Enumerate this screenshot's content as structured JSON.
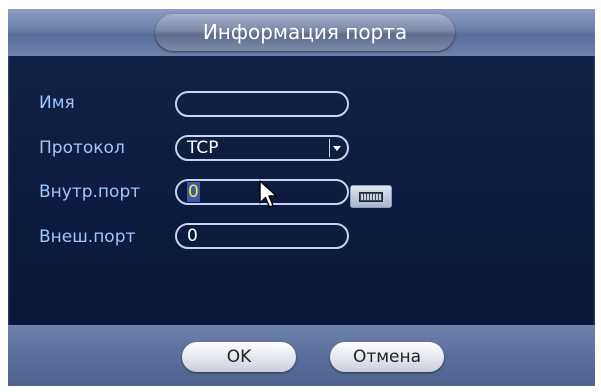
{
  "dialog": {
    "title": "Информация порта"
  },
  "form": {
    "name_label": "Имя",
    "name_value": "",
    "protocol_label": "Протокол",
    "protocol_value": "TCP",
    "internal_port_label": "Внутр.порт",
    "internal_port_value": "0",
    "external_port_label": "Внеш.порт",
    "external_port_value": "0"
  },
  "buttons": {
    "ok": "OK",
    "cancel": "Отмена"
  },
  "icons": {
    "keyboard": "keyboard-icon",
    "dropdown": "chevron-down-icon",
    "cursor": "mouse-pointer-icon"
  },
  "colors": {
    "background": "#0d1b40",
    "label": "#9fc6ff",
    "highlight_value": "#f6ea3a"
  }
}
